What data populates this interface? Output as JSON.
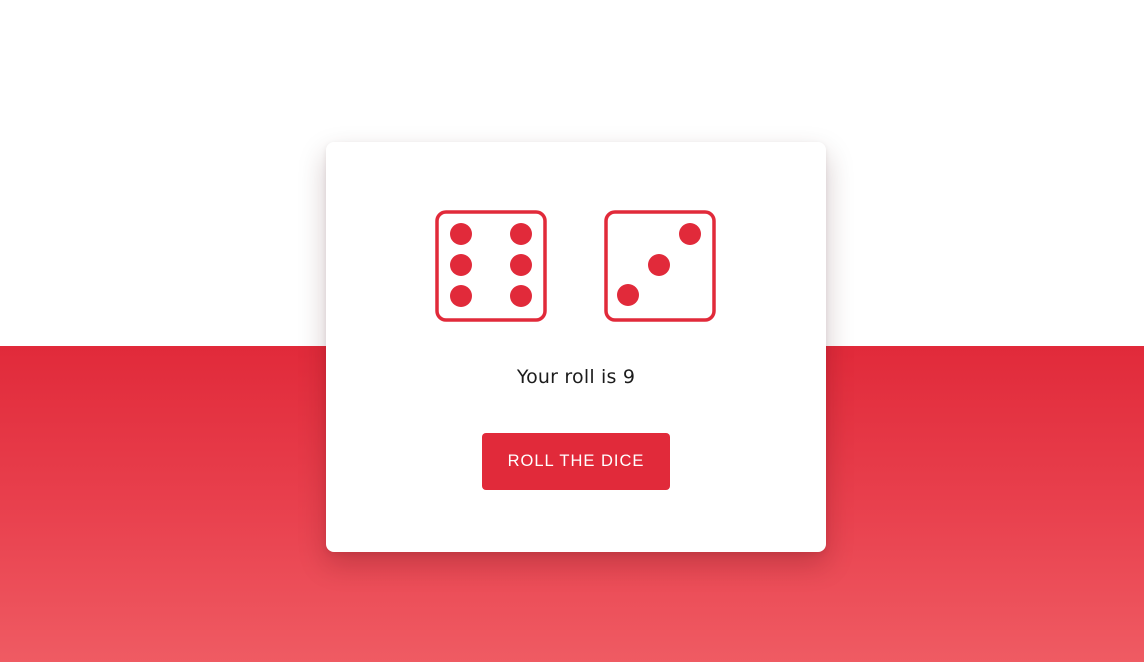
{
  "game": {
    "dice": [
      {
        "face": 6,
        "icon": "dice-six-icon"
      },
      {
        "face": 3,
        "icon": "dice-three-icon"
      }
    ],
    "result_text": "Your roll is 9",
    "roll_button_label": "ROLL THE DICE"
  },
  "colors": {
    "accent": "#e12a3a",
    "background_top": "#ffffff",
    "background_bottom_start": "#e12a3a",
    "background_bottom_end": "#ef5b63",
    "card": "#ffffff",
    "text": "#1c1c1c"
  }
}
